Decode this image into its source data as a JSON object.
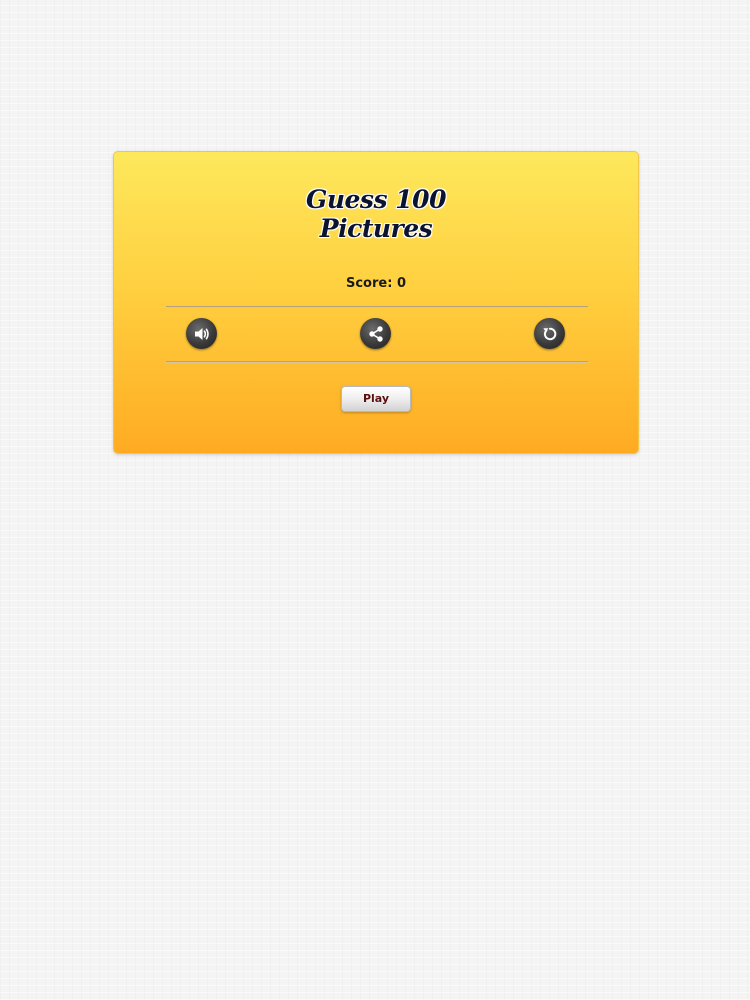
{
  "menu": {
    "title_line1": "Guess 100",
    "title_line2": "Pictures",
    "score_label": "Score:",
    "score_value": "0",
    "play_label": "Play"
  },
  "icons": {
    "sound": "speaker-volume-icon",
    "share": "share-icon",
    "reset": "reset-icon"
  },
  "colors": {
    "card_top": "#fde85c",
    "card_bottom": "#ffab22",
    "icon_button": "#3a3a3a",
    "title_text": "#0b1330",
    "play_text": "#5a1010"
  }
}
